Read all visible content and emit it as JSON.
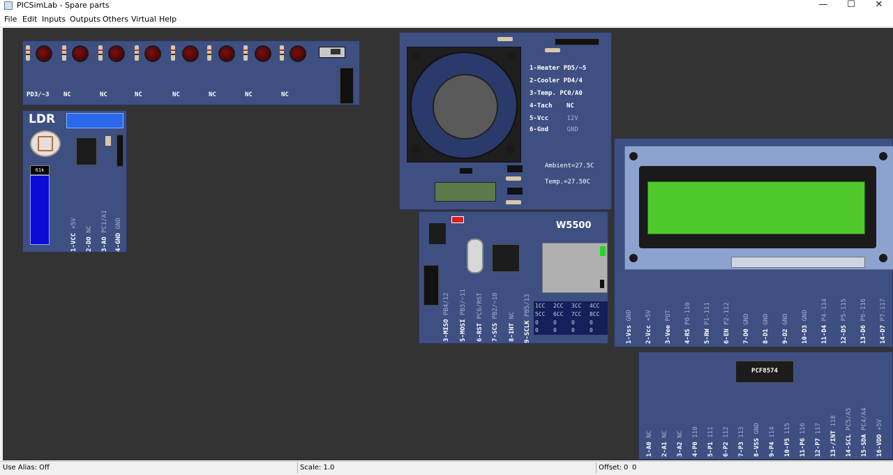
{
  "window": {
    "title": "PICSimLab - Spare parts",
    "minimize": "—",
    "maximize": "☐",
    "close": "✕"
  },
  "menu": [
    "File",
    "Edit",
    "Inputs",
    "Outputs",
    "Others",
    "Virtual",
    "Help"
  ],
  "led_bar": {
    "labels": [
      "PD3/~3",
      "NC",
      "NC",
      "NC",
      "NC",
      "NC",
      "NC",
      "NC"
    ]
  },
  "ldr": {
    "title": "LDR",
    "value": "61k",
    "pins": [
      {
        "name": "1-VCC",
        "conn": "+5V"
      },
      {
        "name": "2-DO",
        "conn": "NC"
      },
      {
        "name": "3-AO",
        "conn": "PC1/A1"
      },
      {
        "name": "4-GND",
        "conn": "GND"
      }
    ]
  },
  "fan": {
    "pins": [
      {
        "name": "1-Heater",
        "conn": "PD5/~5"
      },
      {
        "name": "2-Cooler",
        "conn": "PD4/4"
      },
      {
        "name": "3-Temp.",
        "conn": "PC0/A0"
      },
      {
        "name": "4-Tach",
        "conn": "NC"
      },
      {
        "name": "5-Vcc",
        "conn": "12V"
      },
      {
        "name": "6-Gnd",
        "conn": "GND"
      }
    ],
    "ambient": "Ambient=27.5C",
    "temp": "Temp.=27.50C"
  },
  "w5500": {
    "title": "W5500",
    "pins": [
      {
        "name": "3-MISO",
        "conn": "PB4/12"
      },
      {
        "name": "5-MOSI",
        "conn": "PB3/~11"
      },
      {
        "name": "6-RST",
        "conn": "PC6/RST"
      },
      {
        "name": "7-SCS",
        "conn": "PB2/~10"
      },
      {
        "name": "8-INT",
        "conn": "NC"
      },
      {
        "name": "9-SCLK",
        "conn": "PB5/13"
      }
    ],
    "table_header1": [
      "1CC",
      "2CC",
      "3CC",
      "4CC"
    ],
    "table_header2": [
      "5CC",
      "6CC",
      "7CC",
      "8CC"
    ],
    "row1": [
      "0",
      "0",
      "0",
      "0"
    ],
    "row2": [
      "0",
      "0",
      "0",
      "0"
    ]
  },
  "lcd": {
    "pins": [
      {
        "name": "1-Vss",
        "conn": "GND"
      },
      {
        "name": "2-Vcc",
        "conn": "+5V"
      },
      {
        "name": "3-Vee",
        "conn": "POT"
      },
      {
        "name": "4-RS",
        "conn": "P0-110"
      },
      {
        "name": "5-RW",
        "conn": "P1-111"
      },
      {
        "name": "6-EN",
        "conn": "P2-112"
      },
      {
        "name": "7-D0",
        "conn": "GND"
      },
      {
        "name": "8-D1",
        "conn": "GND"
      },
      {
        "name": "9-D2",
        "conn": "GND"
      },
      {
        "name": "10-D3",
        "conn": "GND"
      },
      {
        "name": "11-D4",
        "conn": "P4-114"
      },
      {
        "name": "12-D5",
        "conn": "P5-115"
      },
      {
        "name": "13-D6",
        "conn": "P6-116"
      },
      {
        "name": "14-D7",
        "conn": "P7-117"
      }
    ]
  },
  "pcf": {
    "chip": "PCF8574",
    "pins": [
      {
        "name": "1-A0",
        "conn": "NC"
      },
      {
        "name": "2-A1",
        "conn": "NC"
      },
      {
        "name": "3-A2",
        "conn": "NC"
      },
      {
        "name": "4-P0",
        "conn": "110"
      },
      {
        "name": "5-P1",
        "conn": "111"
      },
      {
        "name": "6-P2",
        "conn": "112"
      },
      {
        "name": "7-P3",
        "conn": "113"
      },
      {
        "name": "8-VSS",
        "conn": "GND"
      },
      {
        "name": "9-P4",
        "conn": "114"
      },
      {
        "name": "10-P5",
        "conn": "115"
      },
      {
        "name": "11-P6",
        "conn": "116"
      },
      {
        "name": "12-P7",
        "conn": "117"
      },
      {
        "name": "13-/INT",
        "conn": "118"
      },
      {
        "name": "14-SCL",
        "conn": "PC5/A5"
      },
      {
        "name": "15-SDA",
        "conn": "PC4/A4"
      },
      {
        "name": "16-VDD",
        "conn": "+5V"
      }
    ]
  },
  "status": {
    "alias": "Use Alias: Off",
    "scale": "Scale: 1.0",
    "offset_label": "Offset:",
    "offset_x": "0",
    "offset_y": "0"
  }
}
